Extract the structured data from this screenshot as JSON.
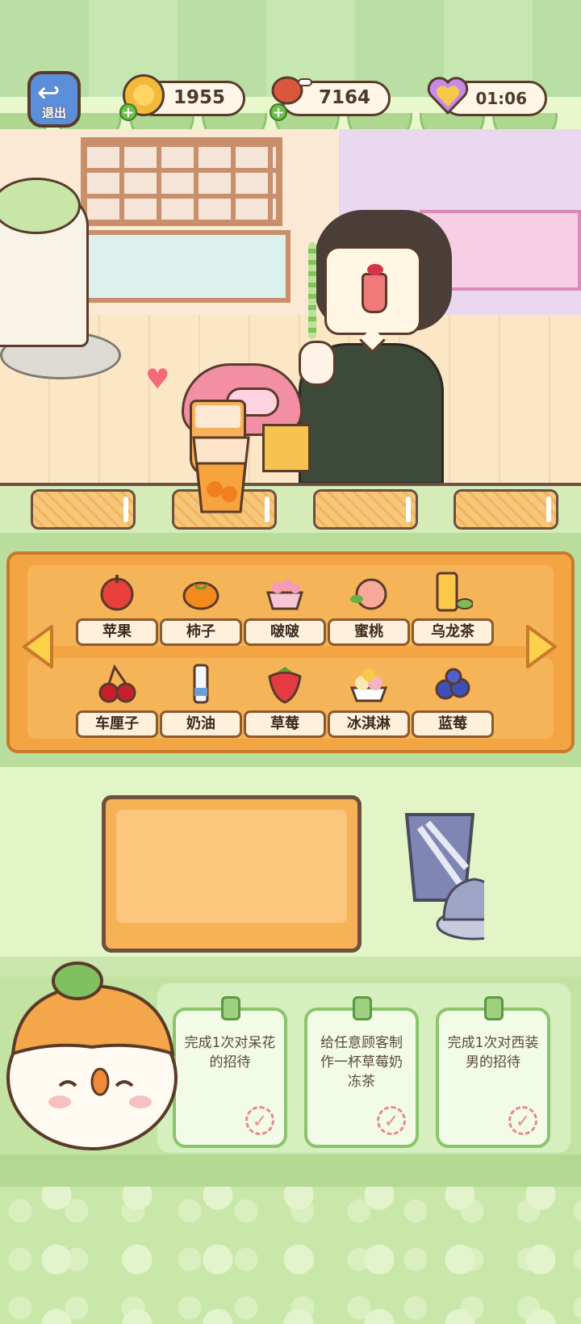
{
  "hud": {
    "exit_label": "退出",
    "coins": "1955",
    "meat": "7164",
    "timer": "01:06"
  },
  "colors": {
    "accent_orange": "#f3a544",
    "accent_green": "#8cc46d",
    "text_brown": "#3a2a20"
  },
  "ingredients": {
    "row1": [
      {
        "label": "苹果",
        "icon": "apple-icon"
      },
      {
        "label": "柿子",
        "icon": "persimmon-icon"
      },
      {
        "label": "啵啵",
        "icon": "boba-icon"
      },
      {
        "label": "蜜桃",
        "icon": "peach-icon"
      },
      {
        "label": "乌龙茶",
        "icon": "oolong-tea-icon"
      }
    ],
    "row2": [
      {
        "label": "车厘子",
        "icon": "cherry-icon"
      },
      {
        "label": "奶油",
        "icon": "cream-icon"
      },
      {
        "label": "草莓",
        "icon": "strawberry-icon"
      },
      {
        "label": "冰淇淋",
        "icon": "ice-cream-icon"
      },
      {
        "label": "蓝莓",
        "icon": "blueberry-icon"
      }
    ]
  },
  "tasks": [
    {
      "text": "完成1次对呆花的招待"
    },
    {
      "text": "给任意顾客制作一杯草莓奶冻茶"
    },
    {
      "text": "完成1次对西装男的招待"
    }
  ]
}
